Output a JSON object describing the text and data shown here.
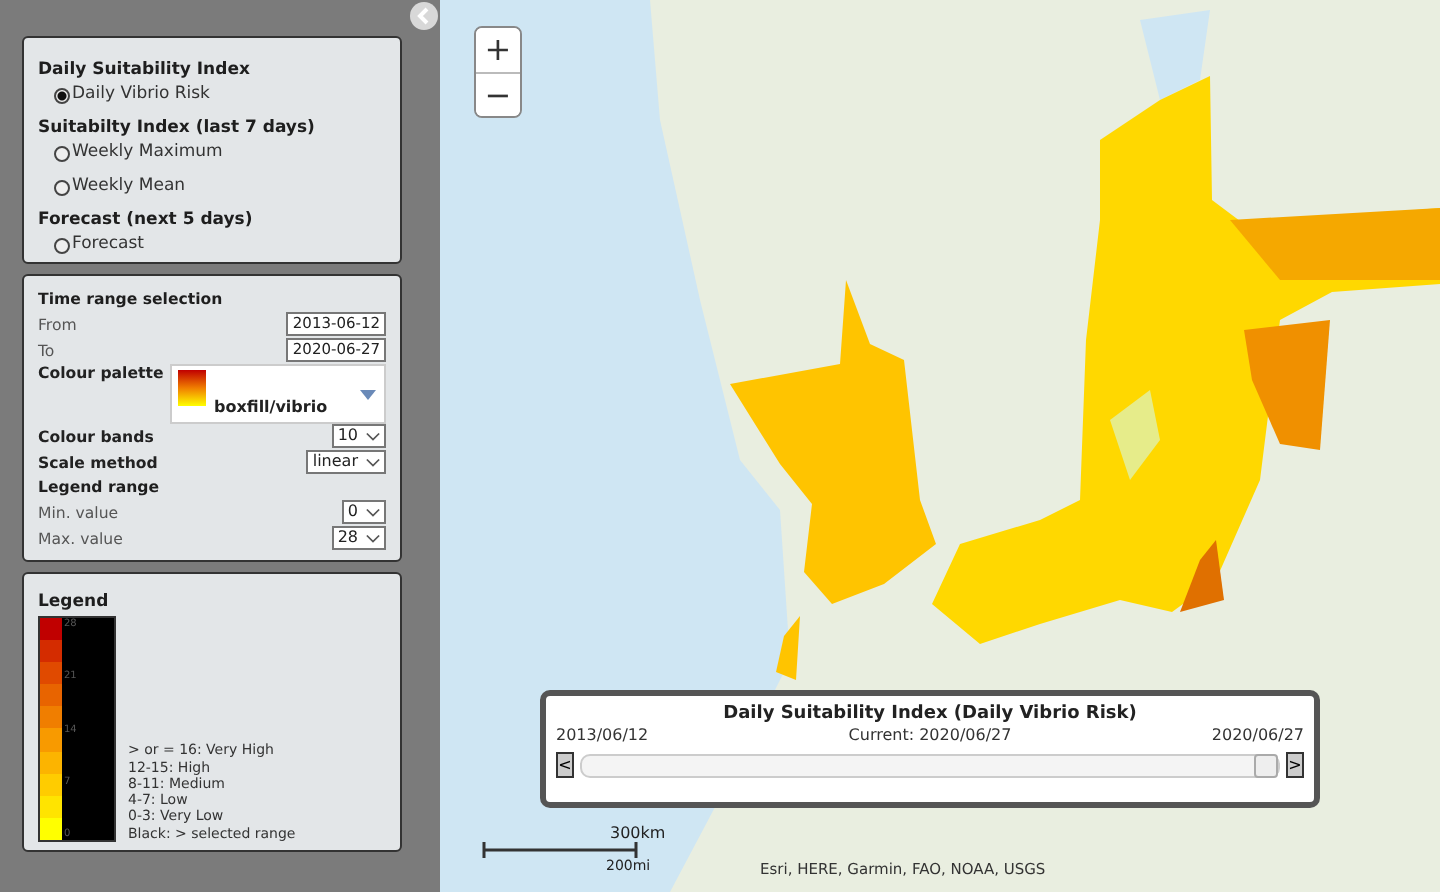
{
  "layer_panel": {
    "groups": [
      {
        "heading": "Daily Suitability Index",
        "options": [
          {
            "label": "Daily Vibrio Risk",
            "selected": true
          }
        ]
      },
      {
        "heading": "Suitabilty Index (last 7 days)",
        "options": [
          {
            "label": "Weekly Maximum",
            "selected": false
          },
          {
            "label": "Weekly Mean",
            "selected": false
          }
        ]
      },
      {
        "heading": "Forecast (next 5 days)",
        "options": [
          {
            "label": "Forecast",
            "selected": false
          }
        ]
      }
    ]
  },
  "settings_panel": {
    "heading": "Time range selection",
    "from": {
      "label": "From",
      "value": "2013-06-12"
    },
    "to": {
      "label": "To",
      "value": "2020-06-27"
    },
    "palette": {
      "label": "Colour palette",
      "value": "boxfill/vibrio"
    },
    "bands": {
      "label": "Colour bands",
      "value": "10"
    },
    "scale": {
      "label": "Scale method",
      "value": "linear"
    },
    "legend_range_heading": "Legend range",
    "min": {
      "label": "Min. value",
      "value": "0"
    },
    "max": {
      "label": "Max. value",
      "value": "28"
    }
  },
  "legend": {
    "title": "Legend",
    "bands": [
      {
        "color": "#c00000"
      },
      {
        "color": "#d42c00"
      },
      {
        "color": "#e04a00"
      },
      {
        "color": "#e86400"
      },
      {
        "color": "#f07e00"
      },
      {
        "color": "#f89a00"
      },
      {
        "color": "#fcb400"
      },
      {
        "color": "#ffcc00"
      },
      {
        "color": "#ffe400"
      },
      {
        "color": "#ffff00"
      }
    ],
    "ticks": [
      "28",
      "21",
      "14",
      "7",
      "0"
    ],
    "descriptions": [
      "> or = 16: Very High",
      "12-15: High",
      "8-11: Medium",
      "4-7: Low",
      "0-3: Very Low",
      "Black: > selected range"
    ]
  },
  "map": {
    "zoom_in": "+",
    "zoom_out": "−",
    "timeline": {
      "title": "Daily Suitability Index (Daily Vibrio Risk)",
      "start": "2013/06/12",
      "current": "Current: 2020/06/27",
      "end": "2020/06/27",
      "prev": "<",
      "next": ">",
      "level": 1
    },
    "scale_labels": [
      "300km",
      "200mi"
    ],
    "attribution": "Esri, HERE, Garmin, FAO, NOAA, USGS"
  }
}
